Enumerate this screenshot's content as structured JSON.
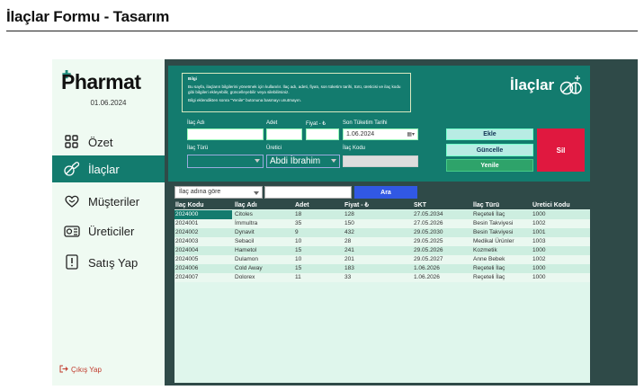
{
  "page_title": "İlaçlar Formu - Tasarım",
  "sidebar": {
    "logo": "Pharmat",
    "date": "01.06.2024",
    "items": [
      {
        "label": "Özet",
        "icon": "grid-icon"
      },
      {
        "label": "İlaçlar",
        "icon": "pills-icon",
        "active": true
      },
      {
        "label": "Müşteriler",
        "icon": "heart-hand-icon"
      },
      {
        "label": "Üreticiler",
        "icon": "factory-icon"
      },
      {
        "label": "Satış Yap",
        "icon": "receipt-icon"
      }
    ],
    "logout": "Çıkış Yap"
  },
  "panel": {
    "title": "İlaçlar",
    "info_heading": "Bilgi",
    "info_text": "Bu sayfa, ilaçların bilgilerini yönetmek için kullanılır. İlaç adı, adeti, fiyatı, son tüketim tarihi, türü, üreticisi ve ilaç kodu gibi bilgileri ekleyebilir, güncelleyebilir veya silebilirsiniz.",
    "info_note": "Bilgi eklendikten sonra \"Yenile\" butonuna basmayı unutmayın."
  },
  "form": {
    "ilac_adi_label": "İlaç Adı",
    "adet_label": "Adet",
    "fiyat_label": "Fiyat - ₺",
    "skt_label": "Son Tüketim Tarihi",
    "skt_value": "1.06.2024",
    "ilac_turu_label": "İlaç Türü",
    "uretici_label": "Üretici",
    "uretici_value": "Abdi İbrahim",
    "ilac_kodu_label": "İlaç Kodu"
  },
  "buttons": {
    "ekle": "Ekle",
    "guncelle": "Güncelle",
    "yenile": "Yenile",
    "sil": "Sil"
  },
  "search": {
    "mode": "İlaç adına göre",
    "button": "Ara"
  },
  "table": {
    "headers": [
      "İlaç Kodu",
      "İlaç Adı",
      "Adet",
      "Fiyat - ₺",
      "SKT",
      "İlaç Türü",
      "Üretici Kodu"
    ],
    "rows": [
      [
        "2024000",
        "Citoles",
        "18",
        "128",
        "27.05.2034",
        "Reçeteli İlaç",
        "1000"
      ],
      [
        "2024001",
        "İmmultra",
        "35",
        "150",
        "27.05.2026",
        "Besin Takviyesi",
        "1002"
      ],
      [
        "2024002",
        "Dynavit",
        "9",
        "432",
        "29.05.2030",
        "Besin Takviyesi",
        "1001"
      ],
      [
        "2024003",
        "Sebacil",
        "10",
        "28",
        "29.05.2025",
        "Medikal Ürünler",
        "1003"
      ],
      [
        "2024004",
        "Hametol",
        "15",
        "241",
        "29.05.2026",
        "Kozmetik",
        "1000"
      ],
      [
        "2024005",
        "Dulamon",
        "10",
        "201",
        "29.05.2027",
        "Anne Bebek",
        "1002"
      ],
      [
        "2024006",
        "Cold Away",
        "15",
        "183",
        "1.06.2026",
        "Reçeteli İlaç",
        "1000"
      ],
      [
        "2024007",
        "Dolorex",
        "11",
        "33",
        "1.06.2026",
        "Reçeteli İlaç",
        "1000"
      ]
    ]
  },
  "colors": {
    "accent": "#137b6e",
    "dark_bg": "#2f4a48",
    "sidebar_bg": "#effaf2",
    "delete": "#e0183f",
    "refresh": "#2ea36a",
    "search": "#3158e4"
  }
}
